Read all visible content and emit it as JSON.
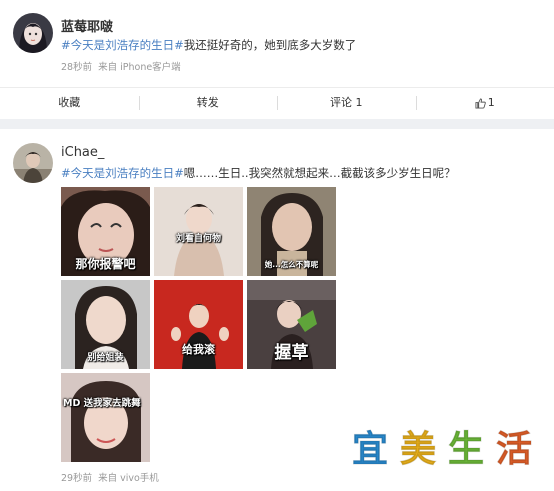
{
  "posts": [
    {
      "username": "蓝莓耶啵",
      "hashtag": "#今天是刘浩存的生日#",
      "text": "我还挺好奇的，她到底多大岁数了",
      "time": "28秒前",
      "source": "来自 iPhone客户端",
      "actions": {
        "favorite": "收藏",
        "repost": "转发",
        "comment": "评论 1",
        "like": "1"
      }
    },
    {
      "username": "iChae_",
      "hashtag": "#今天是刘浩存的生日#",
      "text": "嗯……生日..我突然就想起来…截截该多少岁生日呢？",
      "time": "29秒前",
      "source": "来自 vivo手机",
      "images": [
        {
          "caption": "那你报警吧",
          "bg": "#c9a89a"
        },
        {
          "caption": "刘看自何物",
          "bg": "#d9cfc8"
        },
        {
          "caption": "她...怎么不算呢",
          "bg": "#9c8f7e"
        },
        {
          "caption": "别给姐装",
          "bg": "#bdbdbd"
        },
        {
          "caption": "给我滚",
          "bg": "#c8281f"
        },
        {
          "caption": "握草",
          "bg": "#55494a"
        },
        {
          "caption": "MD 送我家去跳舞",
          "bg": "#d6c7c3"
        }
      ]
    }
  ],
  "watermark": {
    "chars": [
      "宜",
      "美",
      "生",
      "活"
    ],
    "colors": [
      "#2a8fd6",
      "#f0b51c",
      "#6fbe3a",
      "#e8622a"
    ]
  }
}
